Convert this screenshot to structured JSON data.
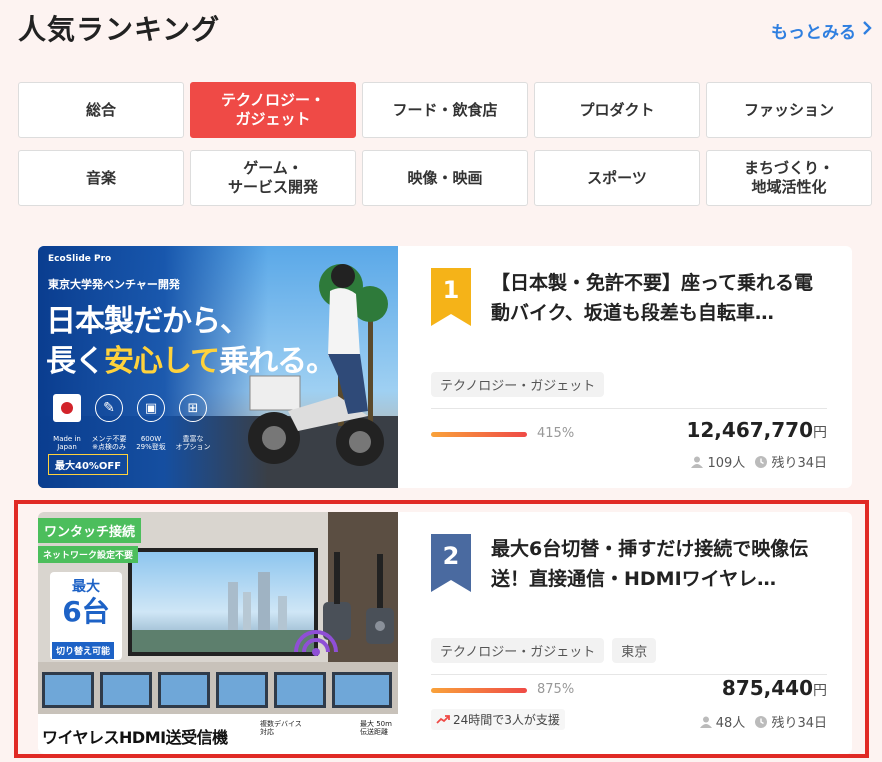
{
  "header": {
    "title": "人気ランキング",
    "more_label": "もっとみる"
  },
  "categories": [
    {
      "label": "総合"
    },
    {
      "label": "テクノロジー・\nガジェット",
      "active": true
    },
    {
      "label": "フード・飲食店"
    },
    {
      "label": "プロダクト"
    },
    {
      "label": "ファッション"
    },
    {
      "label": "音楽"
    },
    {
      "label": "ゲーム・\nサービス開発"
    },
    {
      "label": "映像・映画"
    },
    {
      "label": "スポーツ"
    },
    {
      "label": "まちづくり・\n地域活性化"
    }
  ],
  "items": [
    {
      "rank": "1",
      "title": "【日本製・免許不要】座って乗れる電動バイク、坂道も段差も自転車…",
      "tags": [
        "テクノロジー・ガジェット"
      ],
      "progress_pct": 415,
      "progress_label": "415%",
      "amount": "12,467,770",
      "currency": "円",
      "supporters": "109人",
      "remaining": "残り34日",
      "image": {
        "brand": "EcoSlide Pro",
        "sub": "東京大学発ベンチャー開発",
        "headline1": "日本製だから、",
        "headline2a": "長く",
        "headline2b": "安心して",
        "headline2c": "乗れる。",
        "features": [
          "Made in\nJapan",
          "メンテ不要\n※点検のみ",
          "600W\n29%登坂",
          "豊富な\nオプション"
        ],
        "sale": "最大40%OFF"
      },
      "badge_color": "#f5b318"
    },
    {
      "rank": "2",
      "title": "最大6台切替・挿すだけ接続で映像伝送！直接通信・HDMIワイヤレ…",
      "tags": [
        "テクノロジー・ガジェット",
        "東京"
      ],
      "progress_pct": 875,
      "progress_label": "875%",
      "amount": "875,440",
      "currency": "円",
      "support_note": "24時間で3人が支援",
      "supporters": "48人",
      "remaining": "残り34日",
      "image": {
        "top_label": "ワンタッチ接続",
        "sub_label": "ネットワーク設定不要",
        "max": "最大",
        "num": "6台",
        "switch": "切り替え可能",
        "bottom": "ワイヤレスHDMI送受信機",
        "f1": "複数デバイス\n対応",
        "f2": "最大 50m\n伝送距離"
      },
      "badge_color": "#4a6aa0"
    }
  ],
  "colors": {
    "accent": "#ef4a46",
    "link": "#2f7fe0",
    "highlight": "#e02a25"
  }
}
